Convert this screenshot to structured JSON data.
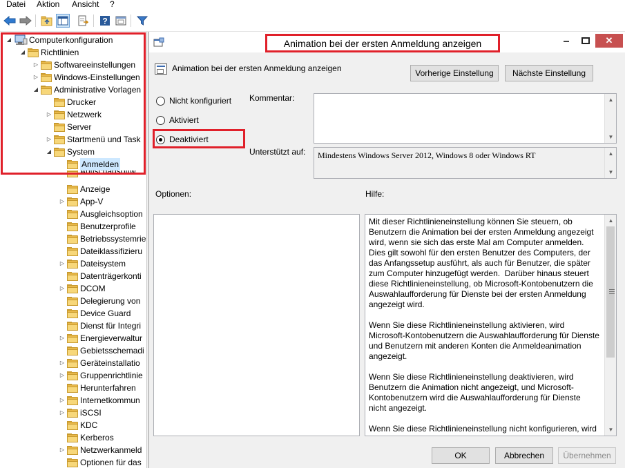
{
  "menu": {
    "items": [
      "Datei",
      "Aktion",
      "Ansicht",
      "?"
    ]
  },
  "toolbar": {
    "buttons": [
      "back-arrow-icon",
      "forward-arrow-icon",
      "up-folder-icon",
      "show-hide-tree-icon",
      "export-list-icon",
      "help-icon",
      "properties-icon",
      "filter-icon"
    ]
  },
  "tree": {
    "root": "Computerkonfiguration",
    "richtlinien": "Richtlinien",
    "softwareeinstellungen": "Softwareeinstellungen",
    "windows_einstellungen": "Windows-Einstellungen",
    "admin_vorlagen": "Administrative Vorlagen",
    "drucker": "Drucker",
    "netzwerk": "Netzwerk",
    "server": "Server",
    "startmenu": "Startmenü und Task",
    "system": "System",
    "anmelden": "Anmelden",
    "antischad": "Antischadsoftw",
    "anzeige": "Anzeige",
    "appv": "App-V",
    "ausgleich": "Ausgleichsoption",
    "benutzerprofile": "Benutzerprofile",
    "betriebssystem": "Betriebssystemrie",
    "dateiklass": "Dateiklassifizieru",
    "dateisystem": "Dateisystem",
    "datentraeger": "Datenträgerkonti",
    "dcom": "DCOM",
    "delegierung": "Delegierung von",
    "deviceguard": "Device Guard",
    "dienstintegr": "Dienst für Integri",
    "energie": "Energieverwaltur",
    "gebiet": "Gebietsschemadi",
    "geraete": "Geräteinstallatio",
    "gruppen": "Gruppenrichtlinie",
    "herunterfahren": "Herunterfahren",
    "internet": "Internetkommun",
    "iscsi": "iSCSI",
    "kdc": "KDC",
    "kerberos": "Kerberos",
    "netzwerkanm": "Netzwerkanmeld",
    "optionen": "Optionen für das"
  },
  "dialog": {
    "title": "Animation bei der ersten Anmeldung anzeigen",
    "subtitle": "Animation bei der ersten Anmeldung anzeigen",
    "prev_button": "Vorherige Einstellung",
    "next_button": "Nächste Einstellung",
    "radio_not_configured": "Nicht konfiguriert",
    "radio_enabled": "Aktiviert",
    "radio_disabled": "Deaktiviert",
    "selected_option": "Deaktiviert",
    "comment_label": "Kommentar:",
    "comment_value": "",
    "supported_label": "Unterstützt auf:",
    "supported_value": "Mindestens Windows Server 2012, Windows 8 oder Windows RT",
    "options_label": "Optionen:",
    "help_label": "Hilfe:",
    "help_paragraphs": [
      "Mit dieser Richtlinieneinstellung können Sie steuern, ob Benutzern die Animation bei der ersten Anmeldung angezeigt wird, wenn sie sich das erste Mal am Computer anmelden.  Dies gilt sowohl für den ersten Benutzer des Computers, der das Anfangssetup ausführt, als auch für Benutzer, die später zum Computer hinzugefügt werden.  Darüber hinaus steuert diese Richtlinieneinstellung, ob Microsoft-Kontobenutzern die Auswahlaufforderung für Dienste bei der ersten Anmeldung angezeigt wird.",
      "Wenn Sie diese Richtlinieneinstellung aktivieren, wird Microsoft-Kontobenutzern die Auswahlaufforderung für Dienste und Benutzern mit anderen Konten die Anmeldeanimation angezeigt.",
      "Wenn Sie diese Richtlinieneinstellung deaktivieren, wird Benutzern die Animation nicht angezeigt, und Microsoft-Kontobenutzern wird die Auswahlaufforderung für Dienste nicht angezeigt.",
      "Wenn Sie diese Richtlinieneinstellung nicht konfigurieren, wird"
    ],
    "ok_button": "OK",
    "cancel_button": "Abbrechen",
    "apply_button": "Übernehmen"
  },
  "colors": {
    "highlight_red": "#e0202a",
    "close_button": "#c75050",
    "folder": "#f7d77a",
    "selection": "#cde8ff"
  }
}
